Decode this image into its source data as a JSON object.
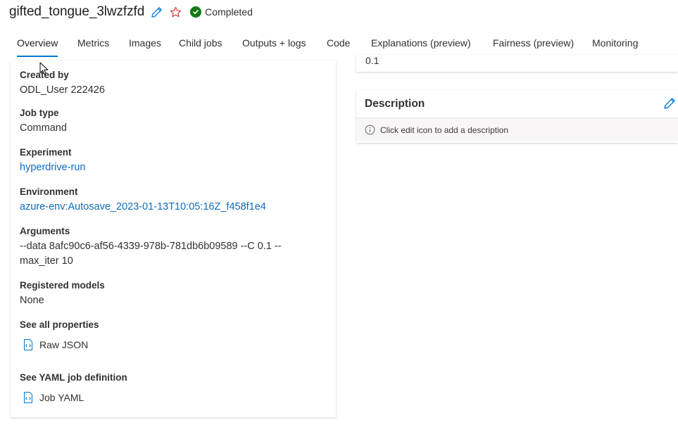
{
  "job": {
    "title": "gifted_tongue_3lwzfzfd",
    "status": "Completed",
    "status_color": "#107c10",
    "icons": [
      "pencil-icon",
      "star-icon",
      "check-circle-icon"
    ]
  },
  "tabs": [
    {
      "label": "Overview",
      "active": true
    },
    {
      "label": "Metrics"
    },
    {
      "label": "Images"
    },
    {
      "label": "Child jobs"
    },
    {
      "label": "Outputs + logs"
    },
    {
      "label": "Code"
    },
    {
      "label": "Explanations (preview)"
    },
    {
      "label": "Fairness (preview)"
    },
    {
      "label": "Monitoring"
    }
  ],
  "properties": {
    "created_by": {
      "label": "Created by",
      "value": "ODL_User 222426"
    },
    "job_type": {
      "label": "Job type",
      "value": "Command"
    },
    "experiment": {
      "label": "Experiment",
      "value": "hyperdrive-run"
    },
    "environment": {
      "label": "Environment",
      "value": "azure-env:Autosave_2023-01-13T10:05:16Z_f458f1e4"
    },
    "arguments": {
      "label": "Arguments",
      "value_line1": "--data 8afc90c6-af56-4339-978b-781db6b09589 --C 0.1 --",
      "value_line2": "max_iter 10"
    },
    "registered_models": {
      "label": "Registered models",
      "value": "None"
    },
    "see_all_properties": {
      "label": "See all properties",
      "link": "Raw JSON"
    },
    "yaml": {
      "label": "See YAML job definition",
      "link": "Job YAML"
    }
  },
  "top_card": {
    "value": "0.1"
  },
  "description": {
    "title": "Description",
    "placeholder": "Click edit icon to add a description"
  },
  "colors": {
    "accent": "#0078d4",
    "link": "#0f6cbd"
  }
}
